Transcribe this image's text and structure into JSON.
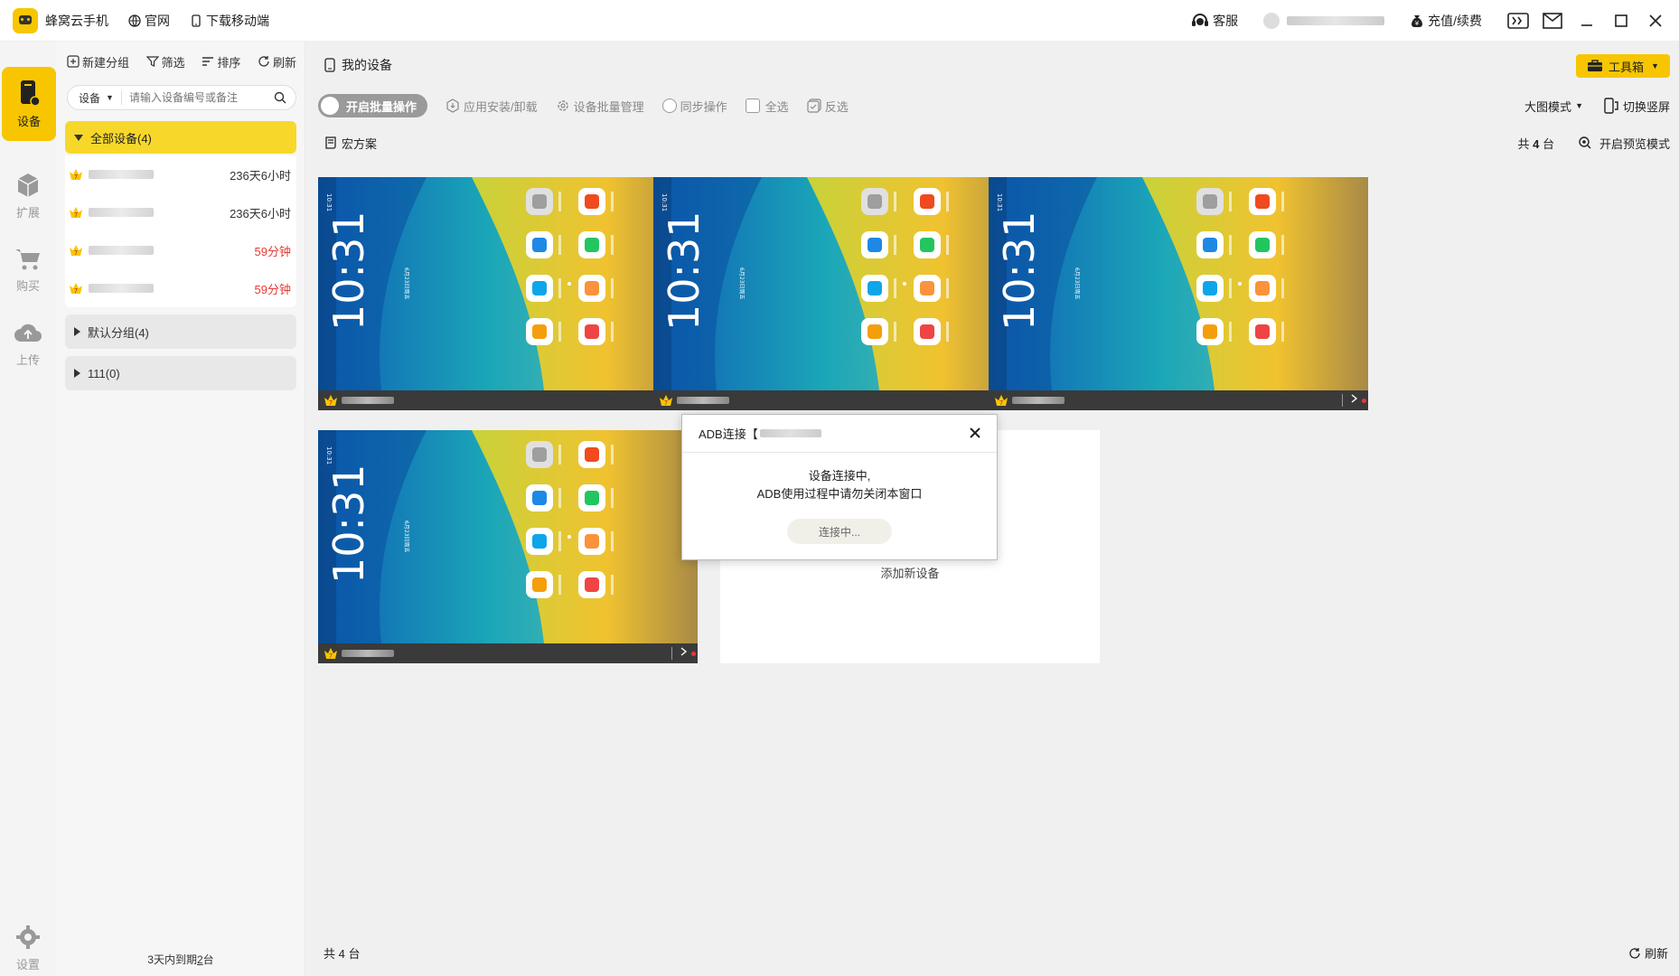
{
  "titlebar": {
    "app_title": "蜂窝云手机",
    "links": [
      "官网",
      "下载移动端"
    ],
    "service": "客服",
    "recharge": "充值/续费"
  },
  "leftnav": {
    "items": [
      {
        "label": "设备",
        "icon": "phone-icon",
        "active": true
      },
      {
        "label": "扩展",
        "icon": "cube-icon",
        "active": false
      },
      {
        "label": "购买",
        "icon": "cart-icon",
        "active": false
      },
      {
        "label": "上传",
        "icon": "cloud-upload-icon",
        "active": false
      },
      {
        "label": "设置",
        "icon": "gear-icon",
        "active": false
      }
    ]
  },
  "groups": {
    "tools": [
      "新建分组",
      "筛选",
      "排序",
      "刷新"
    ],
    "search_select": "设备",
    "search_placeholder": "请输入设备编号或备注",
    "all_label": "全部设备(4)",
    "devices": [
      {
        "time": "236天6小时",
        "urgent": false
      },
      {
        "time": "236天6小时",
        "urgent": false
      },
      {
        "time": "59分钟",
        "urgent": true
      },
      {
        "time": "59分钟",
        "urgent": true
      }
    ],
    "default_group": "默认分组(4)",
    "group_111": "111(0)",
    "footer_pre": "3天内到期",
    "footer_num": "2",
    "footer_post": "台"
  },
  "main": {
    "title": "我的设备",
    "toolbox": "工具箱",
    "batch": "开启批量操作",
    "install": "应用安装/卸载",
    "batch_manage": "设备批量管理",
    "sync": "同步操作",
    "select_all": "全选",
    "invert": "反选",
    "view_mode": "大图模式",
    "switch_screen": "切换竖屏",
    "macro": "宏方案",
    "count_pre": "共",
    "count_num": "4",
    "count_post": "台",
    "preview": "开启预览模式",
    "add_device": "添加新设备",
    "footer_count": "共 4 台",
    "footer_refresh": "刷新"
  },
  "phone": {
    "time": "10:31",
    "small_time": "10:31",
    "date": "6月23日周五"
  },
  "modal": {
    "title_pre": "ADB连接【",
    "line1": "设备连接中,",
    "line2": "ADB使用过程中请勿关闭本窗口",
    "button": "连接中..."
  },
  "colors": {
    "accent": "#f7c600",
    "urgent": "#e53935"
  }
}
